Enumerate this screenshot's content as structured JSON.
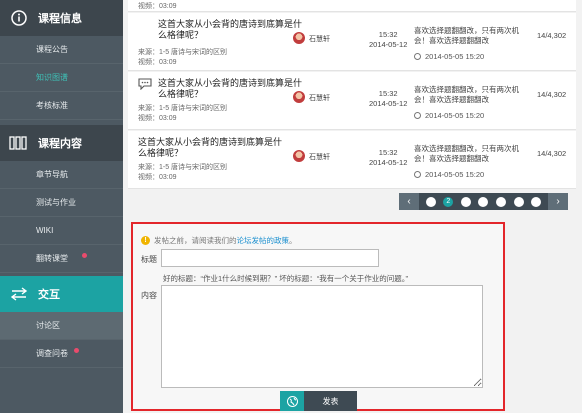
{
  "sidebar": {
    "sections": [
      {
        "label": "课程信息",
        "icon": "info-circle-icon"
      },
      {
        "label": "课程内容",
        "icon": "books-icon"
      },
      {
        "label": "交互",
        "icon": "exchange-arrows-icon"
      }
    ],
    "info_items": [
      {
        "label": "课程公告"
      },
      {
        "label": "知识图谱"
      },
      {
        "label": "考核标准"
      }
    ],
    "content_items": [
      {
        "label": "章节导航"
      },
      {
        "label": "测试与作业"
      },
      {
        "label": "WIKI"
      },
      {
        "label": "翻转课堂"
      }
    ],
    "interact_items": [
      {
        "label": "讨论区"
      },
      {
        "label": "调查问卷"
      }
    ]
  },
  "top_fragment": {
    "text": "视频：03:09"
  },
  "posts": [
    {
      "title": "这首大家从小会背的唐诗到底算是什么格律呢？",
      "source": "来源：1-5 唐诗与宋词的区别",
      "views": "视频：03:09",
      "author": "石慧轩",
      "time": "15:32",
      "date": "2014-05-12",
      "reply": "喜欢选择题翻翻改，只有两次机会！喜欢选择题翻翻改",
      "reply_time": "2014-05-05 15:20",
      "count": "14/4,302"
    },
    {
      "title": "这首大家从小会背的唐诗到底算是什么格律呢？",
      "source": "来源：1-5 唐诗与宋词的区别",
      "views": "视频：03:09",
      "author": "石慧轩",
      "time": "15:32",
      "date": "2014-05-12",
      "reply": "喜欢选择题翻翻改，只有两次机会！喜欢选择题翻翻改",
      "reply_time": "2014-05-05 15:20",
      "count": "14/4,302"
    },
    {
      "title": "这首大家从小会背的唐诗到底算是什么格律呢？",
      "source": "来源：1-5 唐诗与宋词的区别",
      "views": "视频：03:09",
      "author": "石慧轩",
      "time": "15:32",
      "date": "2014-05-12",
      "reply": "喜欢选择题翻翻改，只有两次机会！喜欢选择题翻翻改",
      "reply_time": "2014-05-05 15:20",
      "count": "14/4,302"
    }
  ],
  "pagination": {
    "prev": "‹",
    "next": "›",
    "pages": [
      "",
      "2",
      "",
      "",
      "",
      "",
      ""
    ],
    "current": "2"
  },
  "form": {
    "notice_prefix": "发帖之前，请阅读我们的",
    "notice_link": "论坛发帖的政策",
    "notice_suffix": "。",
    "title_label": "标题",
    "title_value": "",
    "hint": "好的标题：“作业1什么时候到期？”   坏的标题：“我有一个关于作业的问题。”",
    "content_label": "内容",
    "content_value": "",
    "submit_label": "发表"
  },
  "colors": {
    "accent": "#1ca3a3",
    "sidebar": "#4d5962",
    "highlight_border": "#e3262b"
  }
}
